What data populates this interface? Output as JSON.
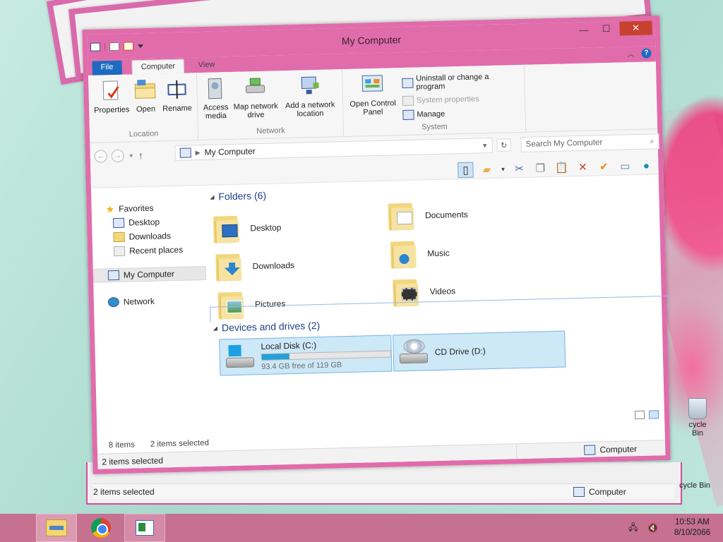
{
  "window": {
    "title": "My Computer",
    "min_glyph": "—",
    "max_glyph": "☐",
    "close_glyph": "✕"
  },
  "ribbon": {
    "tabs": {
      "file": "File",
      "computer": "Computer",
      "view": "View"
    },
    "groups": {
      "location": {
        "label": "Location",
        "buttons": {
          "properties": "Properties",
          "open": "Open",
          "rename": "Rename"
        }
      },
      "network": {
        "label": "Network",
        "buttons": {
          "access_media": "Access media",
          "map_network_drive": "Map network drive",
          "add_network_location": "Add a network location"
        }
      },
      "system": {
        "label": "System",
        "open_control_panel": "Open Control Panel",
        "uninstall": "Uninstall or change a program",
        "system_properties": "System properties",
        "manage": "Manage"
      }
    }
  },
  "address": {
    "crumb": "My Computer",
    "search_placeholder": "Search My Computer"
  },
  "nav": {
    "favorites": "Favorites",
    "desktop": "Desktop",
    "downloads": "Downloads",
    "recent": "Recent places",
    "my_computer": "My Computer",
    "network": "Network"
  },
  "content": {
    "folders_header": "Folders (6)",
    "folders": {
      "desktop": "Desktop",
      "documents": "Documents",
      "downloads": "Downloads",
      "music": "Music",
      "pictures": "Pictures",
      "videos": "Videos"
    },
    "devices_header": "Devices and drives (2)",
    "drives": {
      "c_name": "Local Disk (C:)",
      "c_free": "93.4 GB free of 119 GB",
      "c_used_fraction": 0.215,
      "d_name": "CD Drive (D:)"
    }
  },
  "status": {
    "items": "8 items",
    "selected": "2 items selected",
    "selected_bottom": "2 items selected",
    "computer": "Computer"
  },
  "lower_window": {
    "selected": "2 items selected",
    "computer": "Computer"
  },
  "desktop_icons": {
    "recycle_bin": "cycle Bin",
    "recycle_bin2": "cycle Bin"
  },
  "taskbar": {
    "time": "10:53 AM",
    "date": "8/10/2066"
  }
}
